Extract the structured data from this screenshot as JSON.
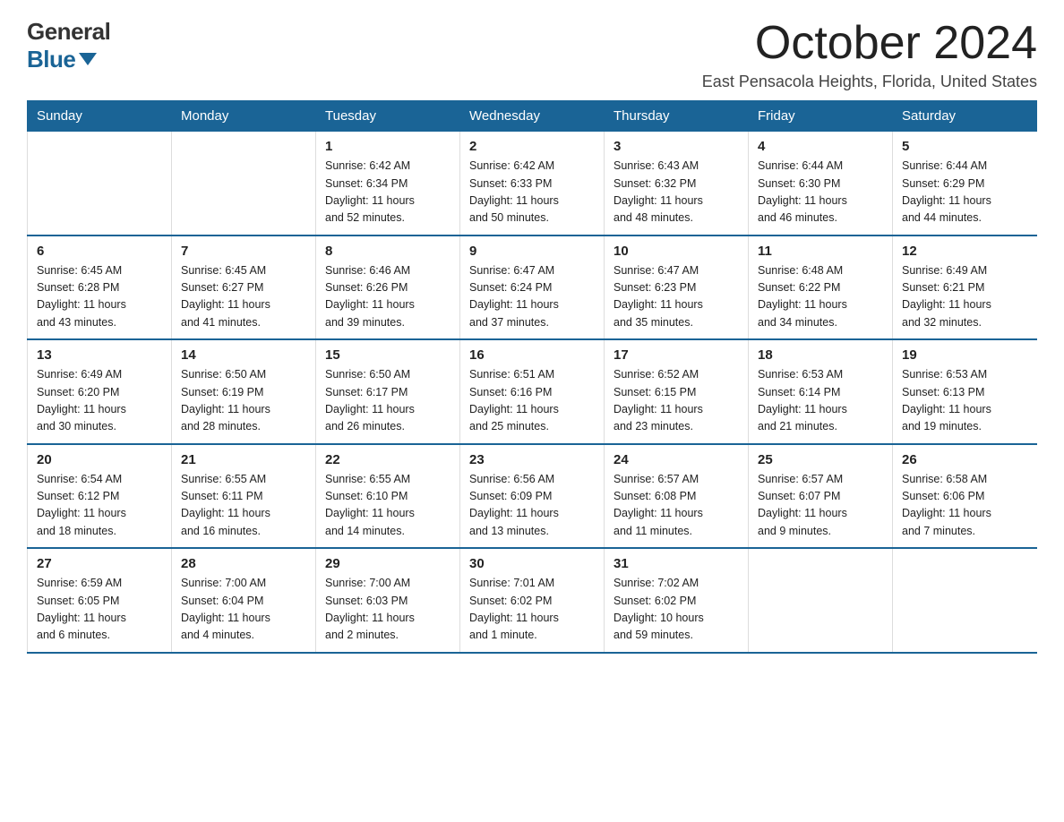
{
  "logo": {
    "general": "General",
    "blue": "Blue"
  },
  "title": "October 2024",
  "subtitle": "East Pensacola Heights, Florida, United States",
  "days_of_week": [
    "Sunday",
    "Monday",
    "Tuesday",
    "Wednesday",
    "Thursday",
    "Friday",
    "Saturday"
  ],
  "weeks": [
    [
      {
        "day": "",
        "info": ""
      },
      {
        "day": "",
        "info": ""
      },
      {
        "day": "1",
        "sunrise": "6:42 AM",
        "sunset": "6:34 PM",
        "daylight": "11 hours and 52 minutes."
      },
      {
        "day": "2",
        "sunrise": "6:42 AM",
        "sunset": "6:33 PM",
        "daylight": "11 hours and 50 minutes."
      },
      {
        "day": "3",
        "sunrise": "6:43 AM",
        "sunset": "6:32 PM",
        "daylight": "11 hours and 48 minutes."
      },
      {
        "day": "4",
        "sunrise": "6:44 AM",
        "sunset": "6:30 PM",
        "daylight": "11 hours and 46 minutes."
      },
      {
        "day": "5",
        "sunrise": "6:44 AM",
        "sunset": "6:29 PM",
        "daylight": "11 hours and 44 minutes."
      }
    ],
    [
      {
        "day": "6",
        "sunrise": "6:45 AM",
        "sunset": "6:28 PM",
        "daylight": "11 hours and 43 minutes."
      },
      {
        "day": "7",
        "sunrise": "6:45 AM",
        "sunset": "6:27 PM",
        "daylight": "11 hours and 41 minutes."
      },
      {
        "day": "8",
        "sunrise": "6:46 AM",
        "sunset": "6:26 PM",
        "daylight": "11 hours and 39 minutes."
      },
      {
        "day": "9",
        "sunrise": "6:47 AM",
        "sunset": "6:24 PM",
        "daylight": "11 hours and 37 minutes."
      },
      {
        "day": "10",
        "sunrise": "6:47 AM",
        "sunset": "6:23 PM",
        "daylight": "11 hours and 35 minutes."
      },
      {
        "day": "11",
        "sunrise": "6:48 AM",
        "sunset": "6:22 PM",
        "daylight": "11 hours and 34 minutes."
      },
      {
        "day": "12",
        "sunrise": "6:49 AM",
        "sunset": "6:21 PM",
        "daylight": "11 hours and 32 minutes."
      }
    ],
    [
      {
        "day": "13",
        "sunrise": "6:49 AM",
        "sunset": "6:20 PM",
        "daylight": "11 hours and 30 minutes."
      },
      {
        "day": "14",
        "sunrise": "6:50 AM",
        "sunset": "6:19 PM",
        "daylight": "11 hours and 28 minutes."
      },
      {
        "day": "15",
        "sunrise": "6:50 AM",
        "sunset": "6:17 PM",
        "daylight": "11 hours and 26 minutes."
      },
      {
        "day": "16",
        "sunrise": "6:51 AM",
        "sunset": "6:16 PM",
        "daylight": "11 hours and 25 minutes."
      },
      {
        "day": "17",
        "sunrise": "6:52 AM",
        "sunset": "6:15 PM",
        "daylight": "11 hours and 23 minutes."
      },
      {
        "day": "18",
        "sunrise": "6:53 AM",
        "sunset": "6:14 PM",
        "daylight": "11 hours and 21 minutes."
      },
      {
        "day": "19",
        "sunrise": "6:53 AM",
        "sunset": "6:13 PM",
        "daylight": "11 hours and 19 minutes."
      }
    ],
    [
      {
        "day": "20",
        "sunrise": "6:54 AM",
        "sunset": "6:12 PM",
        "daylight": "11 hours and 18 minutes."
      },
      {
        "day": "21",
        "sunrise": "6:55 AM",
        "sunset": "6:11 PM",
        "daylight": "11 hours and 16 minutes."
      },
      {
        "day": "22",
        "sunrise": "6:55 AM",
        "sunset": "6:10 PM",
        "daylight": "11 hours and 14 minutes."
      },
      {
        "day": "23",
        "sunrise": "6:56 AM",
        "sunset": "6:09 PM",
        "daylight": "11 hours and 13 minutes."
      },
      {
        "day": "24",
        "sunrise": "6:57 AM",
        "sunset": "6:08 PM",
        "daylight": "11 hours and 11 minutes."
      },
      {
        "day": "25",
        "sunrise": "6:57 AM",
        "sunset": "6:07 PM",
        "daylight": "11 hours and 9 minutes."
      },
      {
        "day": "26",
        "sunrise": "6:58 AM",
        "sunset": "6:06 PM",
        "daylight": "11 hours and 7 minutes."
      }
    ],
    [
      {
        "day": "27",
        "sunrise": "6:59 AM",
        "sunset": "6:05 PM",
        "daylight": "11 hours and 6 minutes."
      },
      {
        "day": "28",
        "sunrise": "7:00 AM",
        "sunset": "6:04 PM",
        "daylight": "11 hours and 4 minutes."
      },
      {
        "day": "29",
        "sunrise": "7:00 AM",
        "sunset": "6:03 PM",
        "daylight": "11 hours and 2 minutes."
      },
      {
        "day": "30",
        "sunrise": "7:01 AM",
        "sunset": "6:02 PM",
        "daylight": "11 hours and 1 minute."
      },
      {
        "day": "31",
        "sunrise": "7:02 AM",
        "sunset": "6:02 PM",
        "daylight": "10 hours and 59 minutes."
      },
      {
        "day": "",
        "info": ""
      },
      {
        "day": "",
        "info": ""
      }
    ]
  ]
}
